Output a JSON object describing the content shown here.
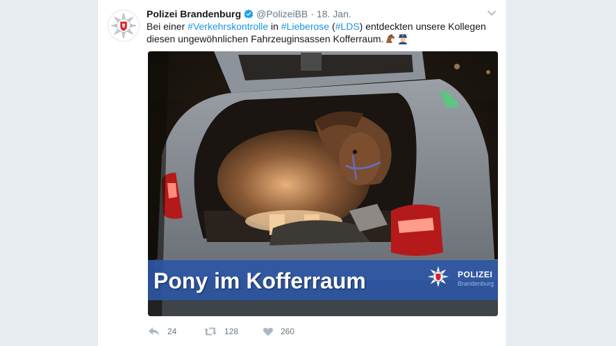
{
  "tweet": {
    "author_name": "Polizei Brandenburg",
    "author_handle": "@PolizeiBB",
    "separator": "·",
    "date": "18. Jan.",
    "text": {
      "part1": "Bei einer ",
      "tag1": "#Verkehrskontrolle",
      "part2": " in ",
      "tag2": "#Lieberose",
      "part3": " (",
      "tag3": "#LDS",
      "part4": ")  entdeckten unsere Kollegen diesen ungewöhnlichen Fahrzeuginsassen Kofferraum."
    },
    "media": {
      "banner_text": "Pony im Kofferraum",
      "banner_org": "POLIZEI",
      "banner_sub": "Brandenburg"
    },
    "actions": {
      "replies": "24",
      "retweets": "128",
      "likes": "260"
    }
  },
  "colors": {
    "link": "#1b95e0",
    "verified": "#1da1f2",
    "meta": "#657786",
    "banner": "#2c56a4"
  },
  "icons": [
    "police-star-icon",
    "verified-badge-icon",
    "chevron-down-icon",
    "horse-emoji-icon",
    "police-officer-emoji-icon",
    "reply-icon",
    "retweet-icon",
    "like-icon"
  ]
}
